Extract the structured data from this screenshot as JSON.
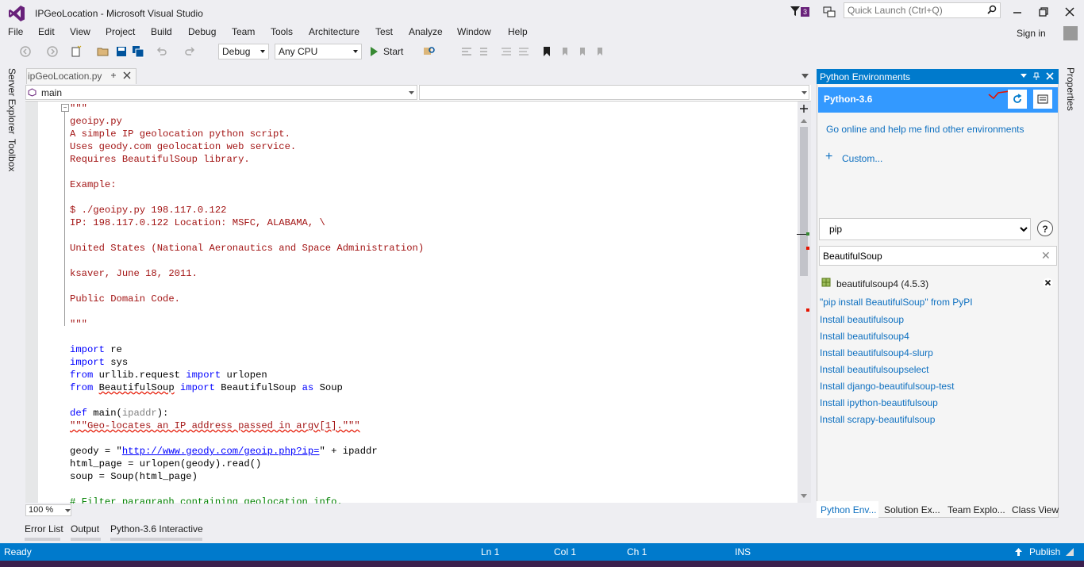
{
  "window": {
    "title": "IPGeoLocation - Microsoft Visual Studio",
    "notification_count": "3",
    "quick_launch_placeholder": "Quick Launch (Ctrl+Q)",
    "sign_in": "Sign in"
  },
  "menu": {
    "items": [
      "File",
      "Edit",
      "View",
      "Project",
      "Build",
      "Debug",
      "Team",
      "Tools",
      "Architecture",
      "Test",
      "Analyze",
      "Window",
      "Help"
    ]
  },
  "toolbar": {
    "config": "Debug",
    "platform": "Any CPU",
    "start_label": "Start"
  },
  "left_tabs": [
    "Server Explorer",
    "Toolbox"
  ],
  "editor": {
    "tab_title": "ipGeoLocation.py",
    "nav_member": "main",
    "zoom": "100 %",
    "code": [
      {
        "t": "\"\"\"",
        "c": "c-str"
      },
      {
        "t": "geoipy.py",
        "c": "c-str"
      },
      {
        "t": "A simple IP geolocation python script.",
        "c": "c-str"
      },
      {
        "t": "Uses geody.com geolocation web service.",
        "c": "c-str"
      },
      {
        "t": "Requires BeautifulSoup library.",
        "c": "c-str"
      },
      {
        "t": "",
        "c": "c-str"
      },
      {
        "t": "Example:",
        "c": "c-str"
      },
      {
        "t": "",
        "c": "c-str"
      },
      {
        "t": "$ ./geoipy.py 198.117.0.122",
        "c": "c-str"
      },
      {
        "t": "IP: 198.117.0.122 Location: MSFC, ALABAMA, \\",
        "c": "c-str"
      },
      {
        "t": "",
        "c": "c-str"
      },
      {
        "t": "United States (National Aeronautics and Space Administration)",
        "c": "c-str"
      },
      {
        "t": "",
        "c": "c-str"
      },
      {
        "t": "ksaver, June 18, 2011.",
        "c": "c-str"
      },
      {
        "t": "",
        "c": "c-str"
      },
      {
        "t": "Public Domain Code.",
        "c": "c-str"
      },
      {
        "t": "",
        "c": "c-str"
      },
      {
        "t": "\"\"\"",
        "c": "c-str"
      },
      {
        "t": "",
        "c": "c-plain"
      },
      {
        "parts": [
          {
            "t": "import",
            "c": "c-kw"
          },
          {
            "t": " re",
            "c": "c-plain"
          }
        ]
      },
      {
        "parts": [
          {
            "t": "import",
            "c": "c-kw"
          },
          {
            "t": " sys",
            "c": "c-plain"
          }
        ]
      },
      {
        "parts": [
          {
            "t": "from",
            "c": "c-kw"
          },
          {
            "t": " urllib.request ",
            "c": "c-plain"
          },
          {
            "t": "import",
            "c": "c-kw"
          },
          {
            "t": " urlopen",
            "c": "c-plain"
          }
        ]
      },
      {
        "parts": [
          {
            "t": "from",
            "c": "c-kw"
          },
          {
            "t": " ",
            "c": "c-plain"
          },
          {
            "t": "BeautifulSoup",
            "c": "c-plain squiggle"
          },
          {
            "t": " ",
            "c": "c-plain"
          },
          {
            "t": "import",
            "c": "c-kw"
          },
          {
            "t": " BeautifulSoup ",
            "c": "c-plain"
          },
          {
            "t": "as",
            "c": "c-kw"
          },
          {
            "t": " Soup",
            "c": "c-plain"
          }
        ]
      },
      {
        "t": "",
        "c": "c-plain"
      },
      {
        "parts": [
          {
            "t": "def",
            "c": "c-kw"
          },
          {
            "t": " main(",
            "c": "c-plain"
          },
          {
            "t": "ipaddr",
            "c": "c-gray"
          },
          {
            "t": "):",
            "c": "c-plain"
          }
        ]
      },
      {
        "t": "\"\"\"Geo-locates an IP address passed in argv[1].\"\"\"",
        "c": "c-str squiggle"
      },
      {
        "t": "",
        "c": "c-plain"
      },
      {
        "parts": [
          {
            "t": "geody = \"",
            "c": "c-plain"
          },
          {
            "t": "http://www.geody.com/geoip.php?ip=",
            "c": "c-link"
          },
          {
            "t": "\" + ipaddr",
            "c": "c-plain"
          }
        ]
      },
      {
        "t": "html_page = urlopen(geody).read()",
        "c": "c-plain"
      },
      {
        "t": "soup = Soup(html_page)",
        "c": "c-plain"
      },
      {
        "t": "",
        "c": "c-plain"
      },
      {
        "t": "# Filter paragraph containing geolocation info.",
        "c": "c-comment"
      }
    ]
  },
  "bottom_tabs": [
    "Error List",
    "Output",
    "Python-3.6 Interactive"
  ],
  "status": {
    "state": "Ready",
    "ln": "Ln 1",
    "col": "Col 1",
    "ch": "Ch 1",
    "mode": "INS",
    "publish": "Publish"
  },
  "python_env": {
    "title": "Python Environments",
    "selected_env": "Python-3.6",
    "online_link": "Go online and help me find other environments",
    "custom_link": "Custom...",
    "view_selected": "pip",
    "search_value": "BeautifulSoup",
    "installed_package": "beautifulsoup4 (4.5.3)",
    "install_links": [
      "\"pip install BeautifulSoup\" from PyPI",
      "Install beautifulsoup",
      "Install beautifulsoup4",
      "Install beautifulsoup4-slurp",
      "Install beautifulsoupselect",
      "Install django-beautifulsoup-test",
      "Install ipython-beautifulsoup",
      "Install scrapy-beautifulsoup"
    ],
    "panel_tabs": [
      "Python Env...",
      "Solution Ex...",
      "Team Explo...",
      "Class View"
    ]
  },
  "right_tabs": [
    "Properties"
  ],
  "colors": {
    "accent": "#007acc",
    "env_selected": "#3399ff",
    "link": "#0e70c0"
  }
}
